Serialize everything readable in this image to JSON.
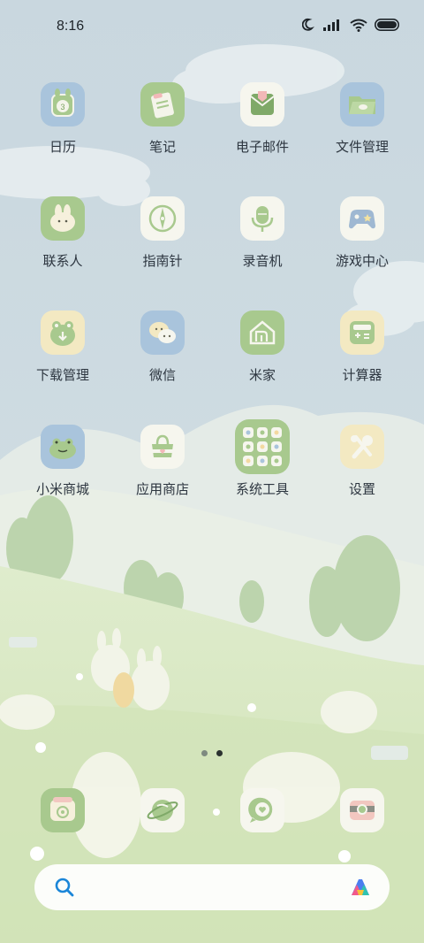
{
  "status_bar": {
    "time": "8:16",
    "icons": [
      "moon-icon",
      "signal-icon",
      "wifi-icon",
      "battery-icon"
    ]
  },
  "apps": [
    {
      "label": "日历",
      "icon": "calendar-icon",
      "bg": "#a9c4dc"
    },
    {
      "label": "笔记",
      "icon": "notes-icon",
      "bg": "#a8c98e"
    },
    {
      "label": "电子邮件",
      "icon": "email-icon",
      "bg": "#f6f6ee"
    },
    {
      "label": "文件管理",
      "icon": "folder-icon",
      "bg": "#a9c4dc"
    },
    {
      "label": "联系人",
      "icon": "contacts-icon",
      "bg": "#a8c98e"
    },
    {
      "label": "指南针",
      "icon": "compass-icon",
      "bg": "#f6f6ee"
    },
    {
      "label": "录音机",
      "icon": "recorder-icon",
      "bg": "#f6f6ee"
    },
    {
      "label": "游戏中心",
      "icon": "gamepad-icon",
      "bg": "#f6f6ee"
    },
    {
      "label": "下载管理",
      "icon": "download-icon",
      "bg": "#f3e9c2"
    },
    {
      "label": "微信",
      "icon": "wechat-icon",
      "bg": "#a9c4dc"
    },
    {
      "label": "米家",
      "icon": "mijia-icon",
      "bg": "#a8c98e"
    },
    {
      "label": "计算器",
      "icon": "calculator-icon",
      "bg": "#f3e9c2"
    },
    {
      "label": "小米商城",
      "icon": "mi-store-icon",
      "bg": "#a9c4dc"
    },
    {
      "label": "应用商店",
      "icon": "app-store-icon",
      "bg": "#f6f6ee"
    },
    {
      "label": "系统工具",
      "icon": "folder-system-tools-icon",
      "bg": "#a8c98e"
    },
    {
      "label": "设置",
      "icon": "settings-icon",
      "bg": "#f3e9c2"
    }
  ],
  "page_indicator": {
    "count": 2,
    "active": 2
  },
  "dock": [
    {
      "icon": "phone-icon",
      "bg": "#a8c98e"
    },
    {
      "icon": "browser-icon",
      "bg": "#f6f6ee"
    },
    {
      "icon": "messages-icon",
      "bg": "#f6f6ee"
    },
    {
      "icon": "camera-icon",
      "bg": "#f6f6ee"
    }
  ],
  "search_bar": {
    "icon": "search-icon",
    "assistant_icon": "assistant-icon"
  },
  "colors": {
    "sky": "#cbd9e0",
    "grass": "#d9e8c3",
    "icon_green": "#a8c98e",
    "icon_blue": "#a9c4dc",
    "icon_cream": "#f3e9c2"
  }
}
